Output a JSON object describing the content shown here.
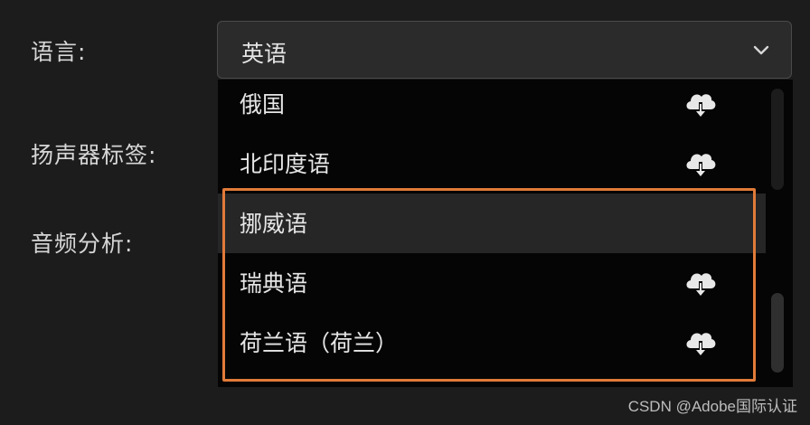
{
  "form": {
    "language_label": "语言:",
    "speaker_label": "扬声器标签:",
    "audio_label": "音频分析:"
  },
  "language_select": {
    "value": "英语"
  },
  "dropdown": {
    "options": [
      {
        "label": "俄国",
        "icon": "cloud-download-icon"
      },
      {
        "label": "北印度语",
        "icon": "cloud-download-icon"
      },
      {
        "label": "挪威语",
        "icon": null,
        "highlighted": true
      },
      {
        "label": "瑞典语",
        "icon": "cloud-download-icon"
      },
      {
        "label": "荷兰语（荷兰）",
        "icon": "cloud-download-icon"
      }
    ]
  },
  "highlight_color": "#e07b39",
  "watermark": "CSDN @Adobe国际认证"
}
